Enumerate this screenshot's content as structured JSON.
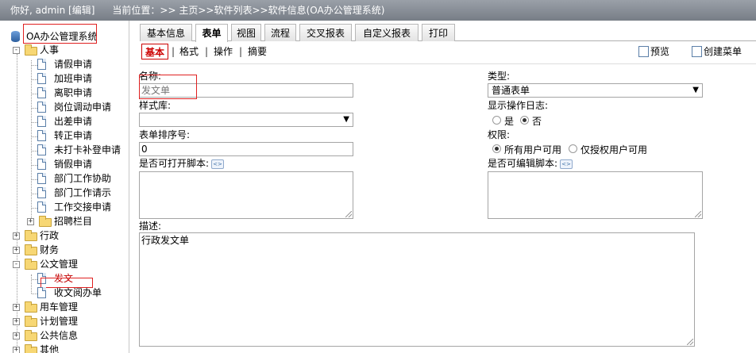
{
  "topbar": {
    "greeting": "你好, admin [编辑]",
    "location": "当前位置：>> 主页>>软件列表>>软件信息(OA办公管理系统)"
  },
  "sidebar": {
    "root": "OA办公管理系统",
    "hr_folder": "人事",
    "hr_items": [
      "请假申请",
      "加班申请",
      "离职申请",
      "岗位调动申请",
      "出差申请",
      "转正申请",
      "未打卡补登申请",
      "销假申请",
      "部门工作协助",
      "部门工作请示",
      "工作交接申请"
    ],
    "recruit": "招聘栏目",
    "folders": {
      "admin": "行政",
      "finance": "财务",
      "docs": "公文管理",
      "car": "用车管理",
      "plan": "计划管理",
      "public": "公共信息",
      "other": "其他"
    },
    "doc_items": [
      "发文",
      "收文阅办单"
    ]
  },
  "tabs": [
    "基本信息",
    "表单",
    "视图",
    "流程",
    "交叉报表",
    "自定义报表",
    "打印"
  ],
  "active_tab": "表单",
  "subtabs": [
    "基本",
    "格式",
    "操作",
    "摘要"
  ],
  "tools": {
    "preview": "预览",
    "create_menu": "创建菜单"
  },
  "form": {
    "name_label": "名称:",
    "name_placeholder": "发文单",
    "style_label": "样式库:",
    "style_value": "",
    "order_label": "表单排序号:",
    "order_value": "0",
    "open_script_label": "是否可打开脚本:",
    "type_label": "类型:",
    "type_value": "普通表单",
    "log_label": "显示操作日志:",
    "log_yes": "是",
    "log_no": "否",
    "perm_label": "权限:",
    "perm_all": "所有用户可用",
    "perm_auth": "仅授权用户可用",
    "edit_script_label": "是否可编辑脚本:",
    "desc_label": "描述:",
    "desc_value": "行政发文单"
  },
  "colors": {
    "accent_red": "#c00000",
    "header_gray": "#8a9099"
  }
}
